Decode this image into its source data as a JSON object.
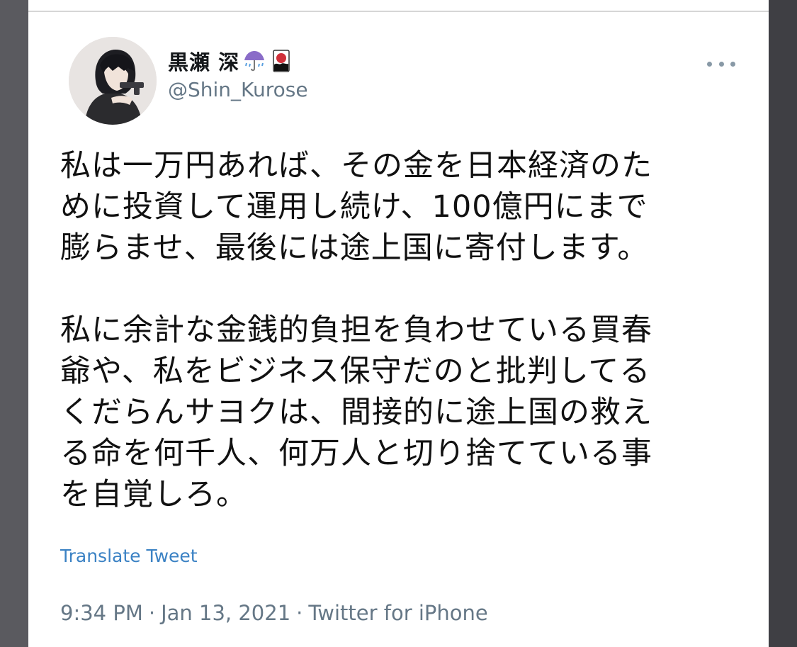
{
  "tweet": {
    "author": {
      "display_name": "黒瀬 深",
      "handle": "@Shin_Kurose",
      "name_emojis": [
        "umbrella-with-rain-icon",
        "hanafuda-icon"
      ]
    },
    "text_lines_1": [
      "私は一万円あれば、その金を日本経済のた",
      "めに投資して運用し続け、100億円にまで",
      "膨らませ、最後には途上国に寄付します。"
    ],
    "text_lines_2": [
      "私に余計な金銭的負担を負わせている買春",
      "爺や、私をビジネス保守だのと批判してる",
      "くだらんサヨクは、間接的に途上国の救え",
      "る命を何千人、何万人と切り捨てている事",
      "を自覚しろ。"
    ],
    "translate_label": "Translate Tweet",
    "time": "9:34 PM",
    "date": "Jan 13, 2021",
    "source": "Twitter for iPhone",
    "separator": "·"
  },
  "colors": {
    "link": "#3b82c4",
    "secondary_text": "#657786",
    "primary_text": "#111111"
  }
}
